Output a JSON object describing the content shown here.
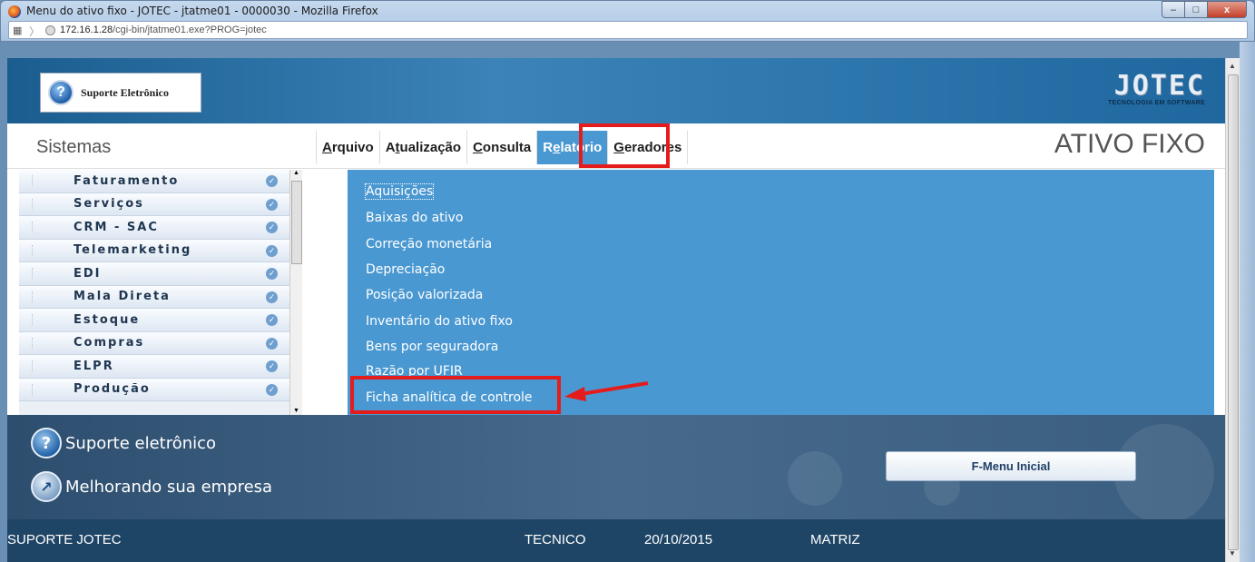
{
  "window": {
    "title": "Menu do ativo fixo - JOTEC - jtatme01 - 0000030 - Mozilla Firefox",
    "url_host": "172.16.1.28",
    "url_path": "/cgi-bin/jtatme01.exe?PROG=jotec",
    "minimize": "–",
    "maximize": "□",
    "close": "x"
  },
  "header": {
    "support_button": "Suporte Eletrônico",
    "logo": "JOTEC",
    "logo_sub": "TECNOLOGIA EM SOFTWARE"
  },
  "menubar": {
    "sistemas": "Sistemas",
    "module_title": "ATIVO FIXO",
    "items": [
      {
        "pre": "",
        "u": "A",
        "post": "rquivo"
      },
      {
        "pre": "A",
        "u": "t",
        "post": "ualização"
      },
      {
        "pre": "",
        "u": "C",
        "post": "onsulta"
      },
      {
        "pre": "R",
        "u": "e",
        "post": "latório"
      },
      {
        "pre": "",
        "u": "G",
        "post": "eradores"
      }
    ],
    "active_index": 3
  },
  "systems": [
    "Faturamento",
    "Serviços",
    "CRM - SAC",
    "Telemarketing",
    "EDI",
    "Mala Direta",
    "Estoque",
    "Compras",
    "ELPR",
    "Produção"
  ],
  "dropdown": [
    "Aquisições",
    "Baixas do ativo",
    "Correção monetária",
    "Depreciação",
    "Posição valorizada",
    "Inventário do ativo fixo",
    "Bens por seguradora",
    "Razão por UFIR",
    "Ficha analítica de controle"
  ],
  "banner": {
    "line1": "Suporte eletrônico",
    "line2": "Melhorando sua empresa",
    "fmenu": "F-Menu Inicial"
  },
  "status": {
    "company": "SUPORTE JOTEC",
    "user": "TECNICO",
    "date": "20/10/2015",
    "branch": "MATRIZ"
  },
  "colors": {
    "menu_active": "#4a98d1",
    "highlight": "#e41c1c",
    "status_bg": "#1f4566"
  }
}
